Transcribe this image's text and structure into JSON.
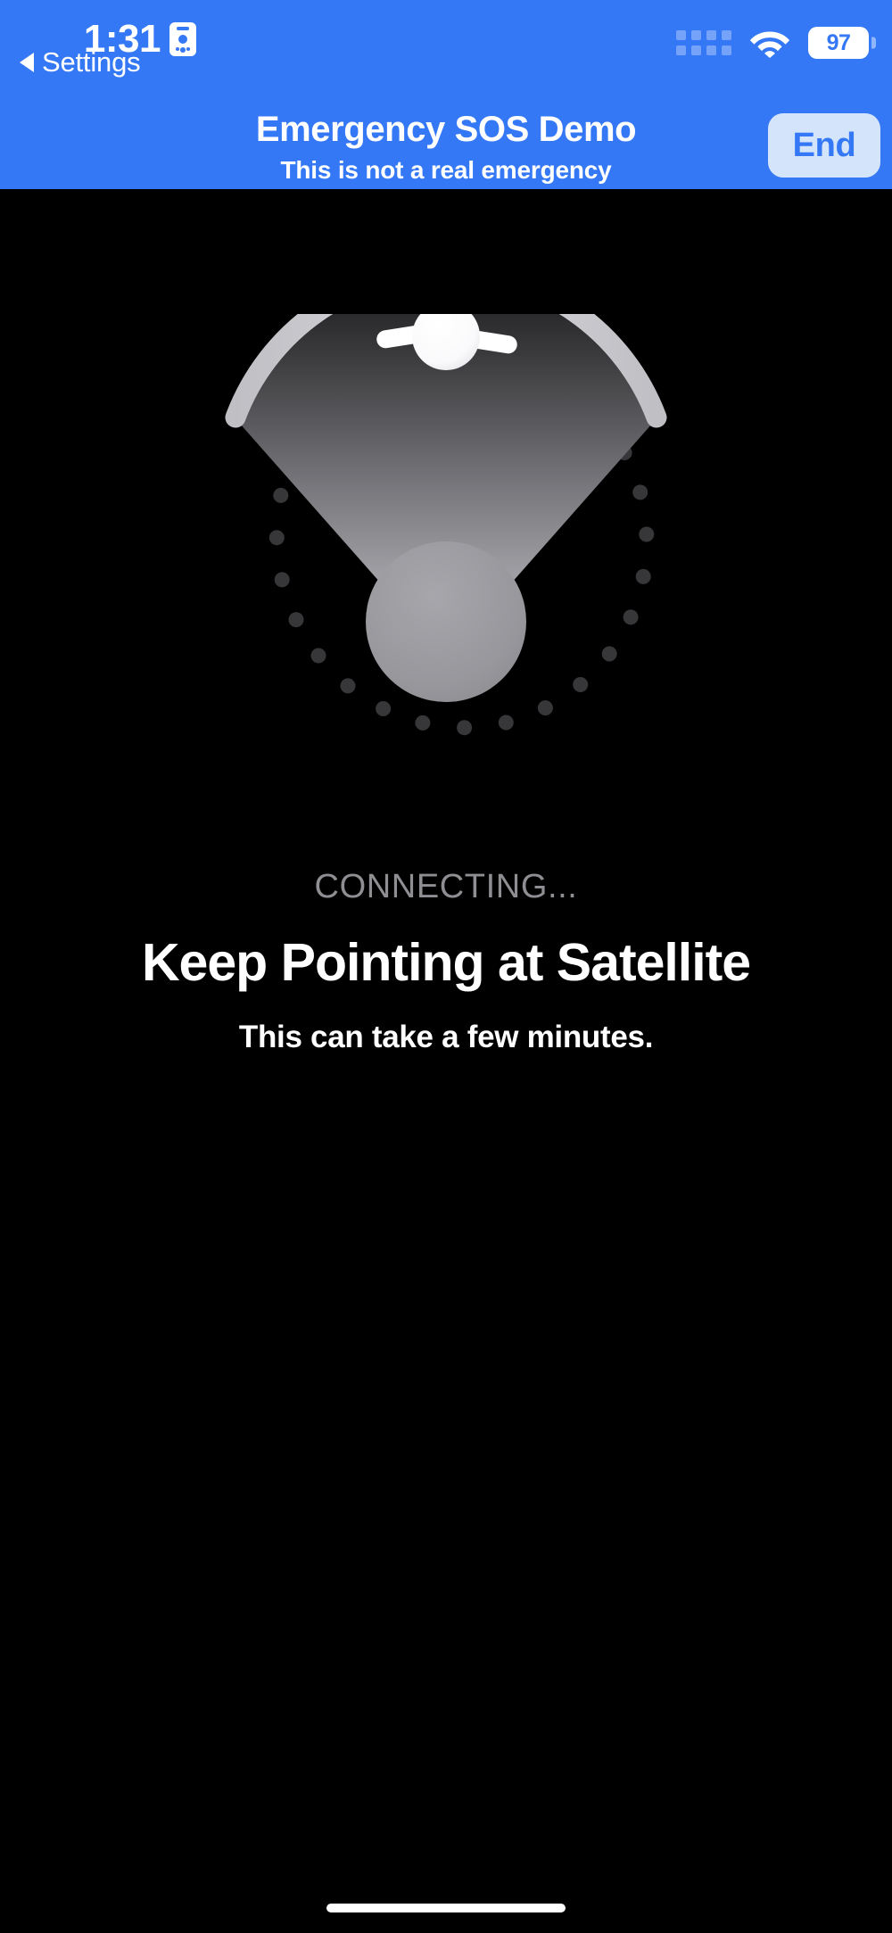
{
  "status_bar": {
    "time": "1:31",
    "location_icon": "id-card-location-icon",
    "cellular_icon": "cellular-signal-icon",
    "wifi_icon": "wifi-icon",
    "battery_level": "97",
    "back_indicator_label": "Settings",
    "back_indicator_icon": "back-triangle-icon",
    "background_color": "#3478F6",
    "foreground_color": "#FFFFFF"
  },
  "nav_bar": {
    "title": "Emergency SOS Demo",
    "subtitle": "This is not a real emergency",
    "end_button_label": "End",
    "end_button_bg": "#D4E4FB",
    "end_button_fg": "#3478F6"
  },
  "main": {
    "illustration_name": "satellite-pointing-dish-graphic",
    "status_caption": "CONNECTING...",
    "headline": "Keep Pointing at Satellite",
    "subline": "This can take a few minutes.",
    "background_color": "#000000",
    "caption_color": "#8E8E93",
    "headline_color": "#FFFFFF",
    "dot_ring_color": "#3A3A3C",
    "beam_color_top": "#2C2C2E",
    "beam_color_bottom": "#B0B0B5",
    "satellite_color": "#FFFFFF",
    "arc_color": "#C9C9CE",
    "sphere_color": "#98989D"
  },
  "home_indicator": {
    "name": "home-indicator-bar"
  }
}
